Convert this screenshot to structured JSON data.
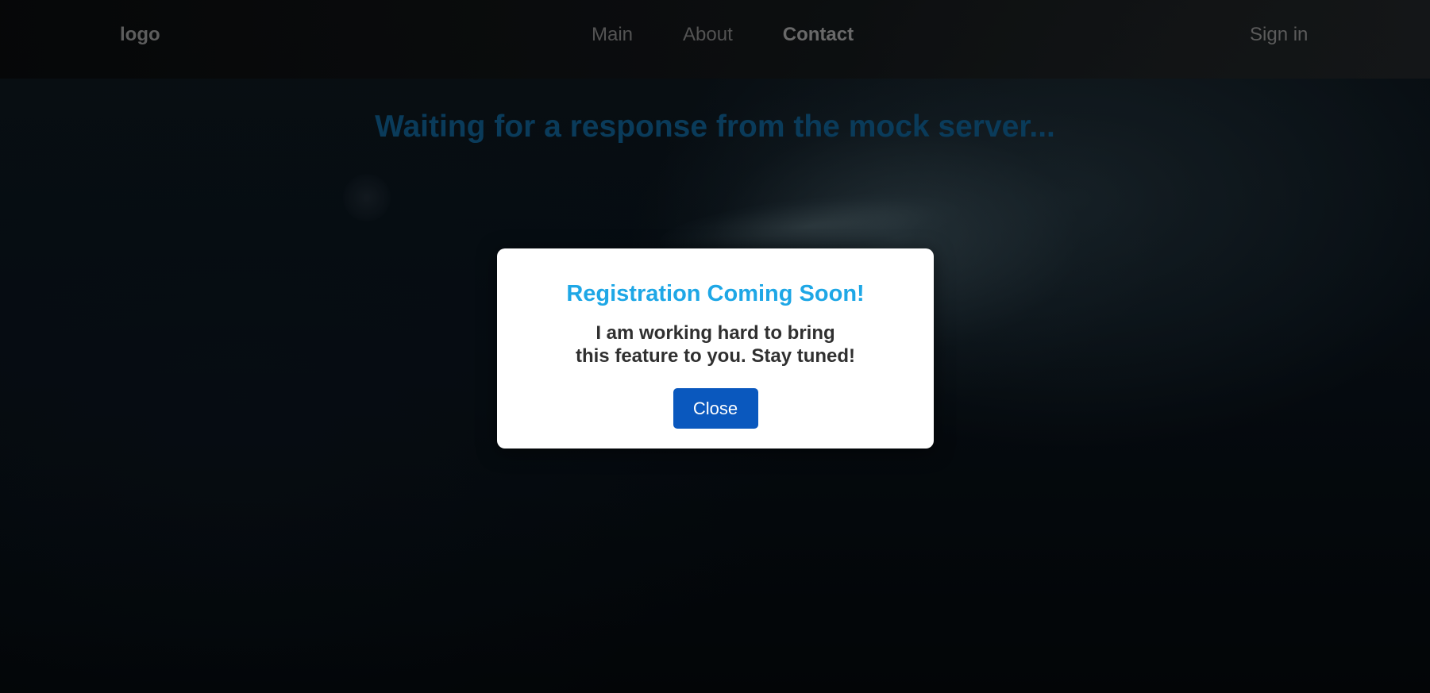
{
  "navbar": {
    "logo": "logo",
    "links": [
      {
        "label": "Main",
        "active": false
      },
      {
        "label": "About",
        "active": false
      },
      {
        "label": "Contact",
        "active": true
      }
    ],
    "sign_in": "Sign in"
  },
  "main": {
    "status_message": "Waiting for a response from the mock server..."
  },
  "modal": {
    "title": "Registration Coming Soon!",
    "message_line1": "I am working hard to bring",
    "message_line2": "this feature to you. Stay tuned!",
    "close_label": "Close"
  },
  "colors": {
    "modal_title": "#1ea7e6",
    "close_button": "#0a58be",
    "status_message": "#0e4f78"
  }
}
